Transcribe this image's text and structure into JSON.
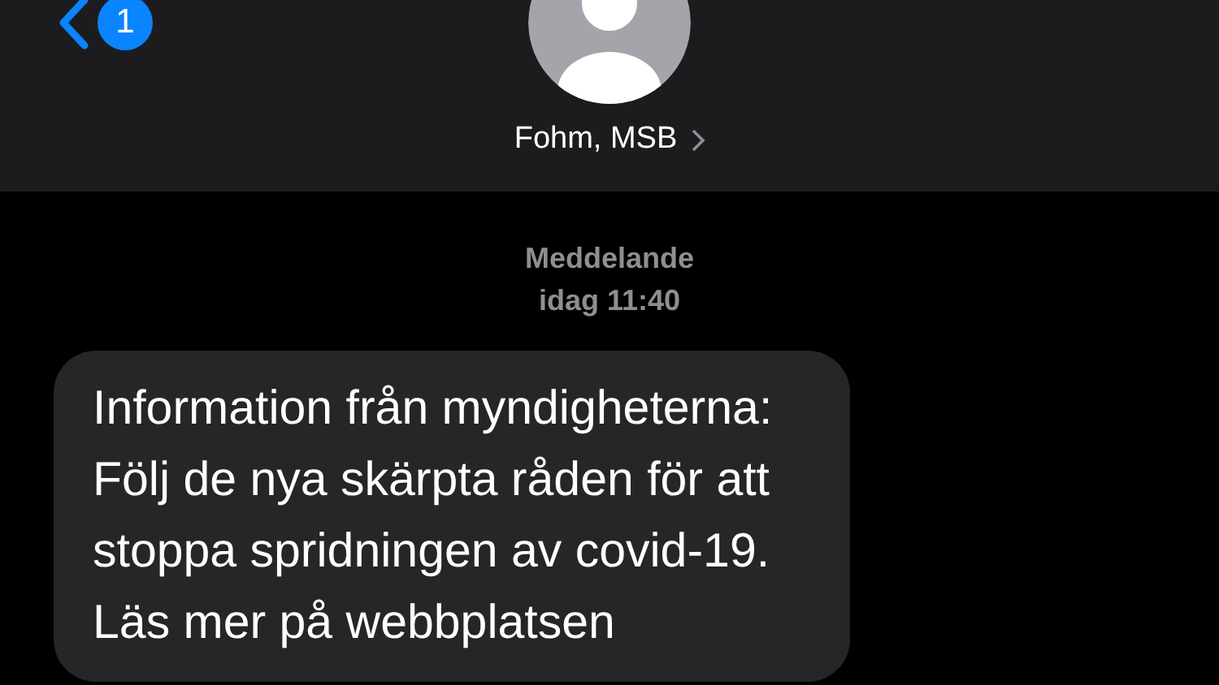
{
  "header": {
    "unread_count": "1",
    "contact_name": "Fohm, MSB"
  },
  "conversation": {
    "service_label": "Meddelande",
    "timestamp": "idag 11:40"
  },
  "messages": [
    {
      "kind": "incoming",
      "text": "Information från myndigheterna: Följ de nya skärpta råden för att stoppa spridningen av covid-19. Läs mer på webbplatsen"
    }
  ]
}
